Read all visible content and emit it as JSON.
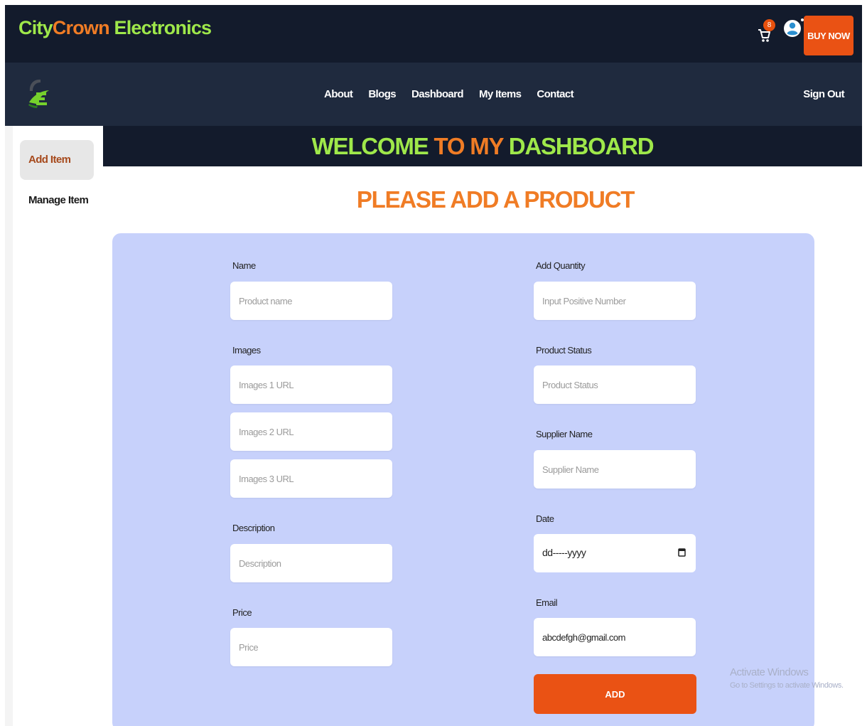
{
  "brand": {
    "part1": "City",
    "part2": "Crown",
    "part3": " Electronics"
  },
  "header": {
    "cart_count": "8",
    "buy_now": "BUY NOW"
  },
  "nav": {
    "links": [
      "About",
      "Blogs",
      "Dashboard",
      "My Items",
      "Contact"
    ],
    "sign_out": "Sign Out"
  },
  "sidebar": {
    "items": [
      {
        "label": "Add Item"
      },
      {
        "label": "Manage Item"
      }
    ]
  },
  "welcome": {
    "part1": "WELCOME ",
    "part2": "TO MY",
    "part3": " DASHBOARD"
  },
  "form": {
    "heading": "PLEASE ADD A PRODUCT",
    "name": {
      "label": "Name",
      "placeholder": "Product name"
    },
    "images": {
      "label": "Images",
      "placeholders": [
        "Images 1 URL",
        "Images 2 URL",
        "Images 3 URL"
      ]
    },
    "description": {
      "label": "Description",
      "placeholder": "Description"
    },
    "price": {
      "label": "Price",
      "placeholder": "Price"
    },
    "quantity": {
      "label": "Add Quantity",
      "placeholder": "Input Positive Number"
    },
    "status": {
      "label": "Product Status",
      "placeholder": "Product Status"
    },
    "supplier": {
      "label": "Supplier Name",
      "placeholder": "Supplier Name"
    },
    "date": {
      "label": "Date",
      "value": "dd-----yyyy"
    },
    "email": {
      "label": "Email",
      "value": "abcdefgh@gmail.com"
    },
    "submit": "ADD"
  },
  "watermark": {
    "line1": "Activate Windows",
    "line2": "Go to Settings to activate Windows."
  },
  "colors": {
    "navy": "#131b2c",
    "nav": "#1f2a3e",
    "green": "#9fe84a",
    "orange": "#f07c25",
    "button": "#ea5214",
    "card": "#c7d1fb"
  }
}
